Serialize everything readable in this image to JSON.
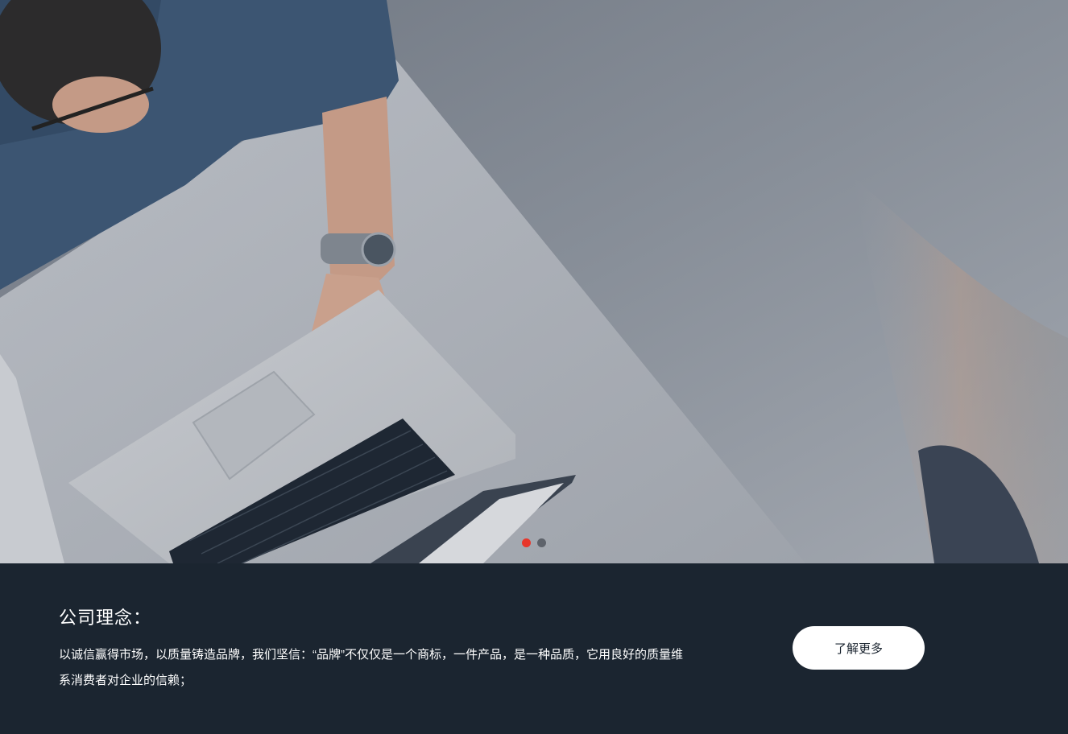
{
  "hero": {
    "slides_count": 2,
    "active_slide": 1
  },
  "info": {
    "title": "公司理念：",
    "text": "以诚信赢得市场，以质量铸造品牌，我们坚信：“品牌”不仅仅是一个商标，一件产品，是一种品质，它用良好的质量维系消费者对企业的信赖；",
    "button_label": "了解更多"
  },
  "colors": {
    "info_background": "#1b2530",
    "active_dot": "#e8362b",
    "inactive_dot": "#5e636b",
    "button_background": "#ffffff"
  }
}
